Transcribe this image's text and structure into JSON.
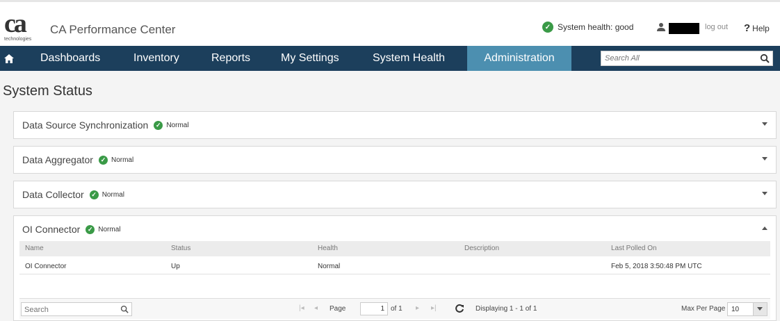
{
  "header": {
    "logo_text": "ca",
    "logo_subtext": "technologies",
    "app_title": "CA Performance Center",
    "system_health": "System health: good",
    "logout": "log out",
    "help": "Help"
  },
  "nav": {
    "items": [
      {
        "label": "Dashboards"
      },
      {
        "label": "Inventory"
      },
      {
        "label": "Reports"
      },
      {
        "label": "My Settings"
      },
      {
        "label": "System Health"
      },
      {
        "label": "Administration",
        "active": true
      }
    ],
    "search_placeholder": "Search All"
  },
  "page": {
    "title": "System Status"
  },
  "panels": [
    {
      "title": "Data Source Synchronization",
      "status": "Normal",
      "expanded": false
    },
    {
      "title": "Data Aggregator",
      "status": "Normal",
      "expanded": false
    },
    {
      "title": "Data Collector",
      "status": "Normal",
      "expanded": false
    },
    {
      "title": "OI Connector",
      "status": "Normal",
      "expanded": true
    }
  ],
  "table": {
    "columns": [
      "Name",
      "Status",
      "Health",
      "Description",
      "Last Polled On"
    ],
    "rows": [
      [
        "OI Connector",
        "Up",
        "Normal",
        "",
        "Feb 5, 2018 3:50:48 PM UTC"
      ]
    ]
  },
  "pager": {
    "search_placeholder": "Search",
    "page_label": "Page",
    "page_value": "1",
    "of_label": "of 1",
    "displaying": "Displaying 1 - 1 of 1",
    "max_per_page_label": "Max Per Page",
    "max_per_page_value": "10"
  },
  "colors": {
    "nav_bg": "#1c3f5c",
    "nav_active": "#4c8fb0",
    "status_green": "#3a9a47"
  }
}
